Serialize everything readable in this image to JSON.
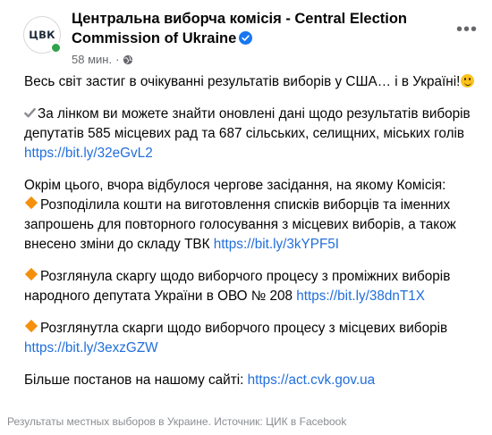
{
  "header": {
    "avatar_text": "ЦВК",
    "page_name": "Центральна виборча комісія - Central Election Commission of Ukraine",
    "timestamp": "58 мин.",
    "separator": "·"
  },
  "post": {
    "p1": "Весь світ застиг в очікуванні результатів виборів у США… і в Україні!",
    "p2_text": "За лінком ви можете знайти оновлені дані щодо результатів виборів депутатів 585 місцевих рад та 687 сільських, селищних, міських голів ",
    "p2_link": "https://bit.ly/32eGvL2",
    "p3": "Окрім цього, вчора відбулося чергове засідання, на якому Комісія:",
    "p3_item1_text": "Розподілила кошти на виготовлення списків виборців та іменних запрошень для повторного голосування з місцевих виборів, а також внесено зміни до складу ТВК ",
    "p3_item1_link": "https://bit.ly/3kYPF5I",
    "p4_text": "Розглянула скаргу щодо виборчого процесу з проміжних виборів народного депутата України в ОВО № 208 ",
    "p4_link": "https://bit.ly/38dnT1X",
    "p5_text": "Розглянутла скарги щодо виборчого процесу з місцевих виборів ",
    "p5_link": "https://bit.ly/3exzGZW",
    "p6_text": "Більше постанов на нашому сайті: ",
    "p6_link": "https://act.cvk.gov.ua"
  },
  "caption": "Результаты местных выборов в Украине. Источник: ЦИК в Facebook",
  "colors": {
    "link": "#216fdb",
    "meta": "#65676b",
    "verified": "#1877f2",
    "online": "#31a24c"
  }
}
